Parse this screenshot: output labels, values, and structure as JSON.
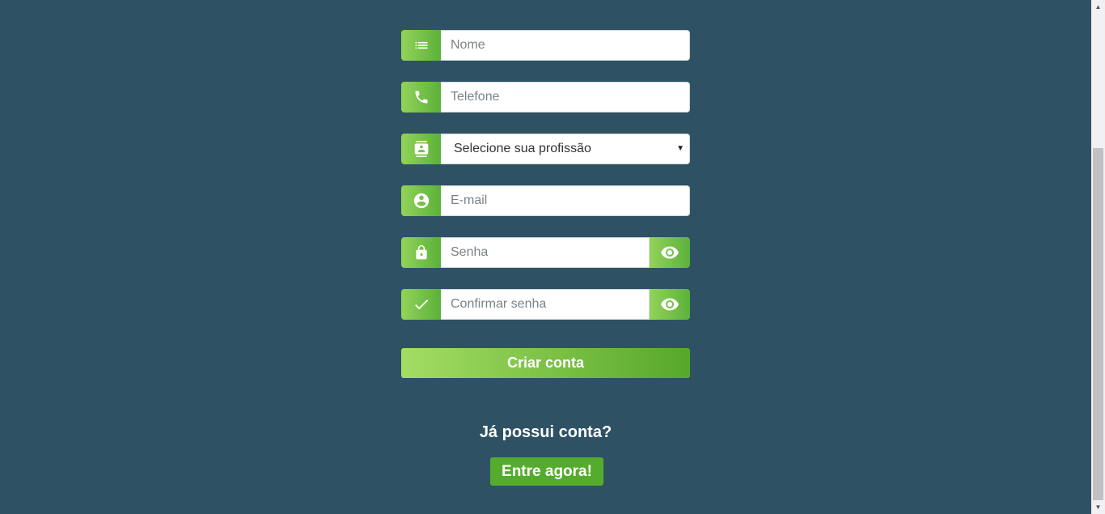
{
  "form": {
    "name_placeholder": "Nome",
    "phone_placeholder": "Telefone",
    "profession_select_value": "Selecione sua profissão",
    "email_placeholder": "E-mail",
    "password_placeholder": "Senha",
    "confirm_password_placeholder": "Confirmar senha",
    "submit_label": "Criar conta"
  },
  "login": {
    "question": "Já possui conta?",
    "button_label": "Entre agora!"
  },
  "icons": {
    "name": "list-icon",
    "phone": "phone-icon",
    "profession": "contact-card-icon",
    "email": "account-circle-icon",
    "password": "lock-icon",
    "confirm": "check-icon",
    "toggle": "eye-icon"
  },
  "colors": {
    "background": "#2e5263",
    "accent_light": "#93d35a",
    "accent_dark": "#55ab2e",
    "text_white": "#ffffff"
  }
}
